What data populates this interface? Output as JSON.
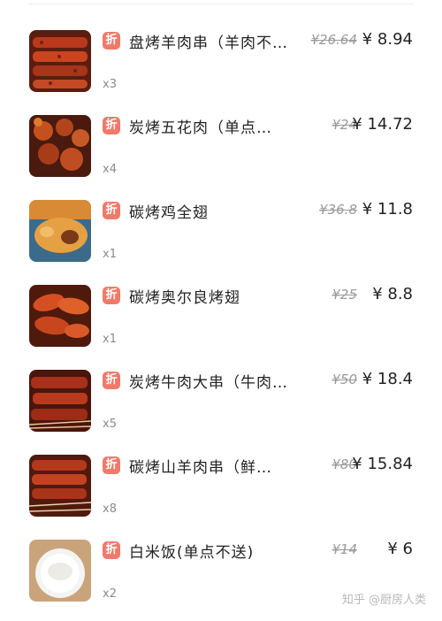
{
  "items": [
    {
      "name": "盘烤羊肉串（羊肉不…",
      "original_price": "¥26.64",
      "price": "¥ 8.94",
      "quantity": "x3",
      "badge": "折",
      "image": "lamb-skewers"
    },
    {
      "name": "炭烤五花肉（单点…",
      "original_price": "¥24",
      "price": "¥ 14.72",
      "quantity": "x4",
      "badge": "折",
      "image": "pork-belly"
    },
    {
      "name": "碳烤鸡全翅",
      "original_price": "¥36.8",
      "price": "¥ 11.8",
      "quantity": "x1",
      "badge": "折",
      "image": "chicken-wing"
    },
    {
      "name": "碳烤奥尔良烤翅",
      "original_price": "¥25",
      "price": "¥ 8.8",
      "quantity": "x1",
      "badge": "折",
      "image": "orleans-wings"
    },
    {
      "name": "炭烤牛肉大串（牛肉…",
      "original_price": "¥50",
      "price": "¥ 18.4",
      "quantity": "x5",
      "badge": "折",
      "image": "beef-skewers"
    },
    {
      "name": "碳烤山羊肉串（鲜…",
      "original_price": "¥80",
      "price": "¥ 15.84",
      "quantity": "x8",
      "badge": "折",
      "image": "goat-skewers"
    },
    {
      "name": "白米饭(单点不送)",
      "original_price": "¥14",
      "price": "¥ 6",
      "quantity": "x2",
      "badge": "折",
      "image": "white-rice"
    }
  ],
  "watermark": "知乎 @厨房人类",
  "colors": {
    "badge": "#f07a6a",
    "text": "#222222",
    "muted": "#9a9a9a"
  }
}
